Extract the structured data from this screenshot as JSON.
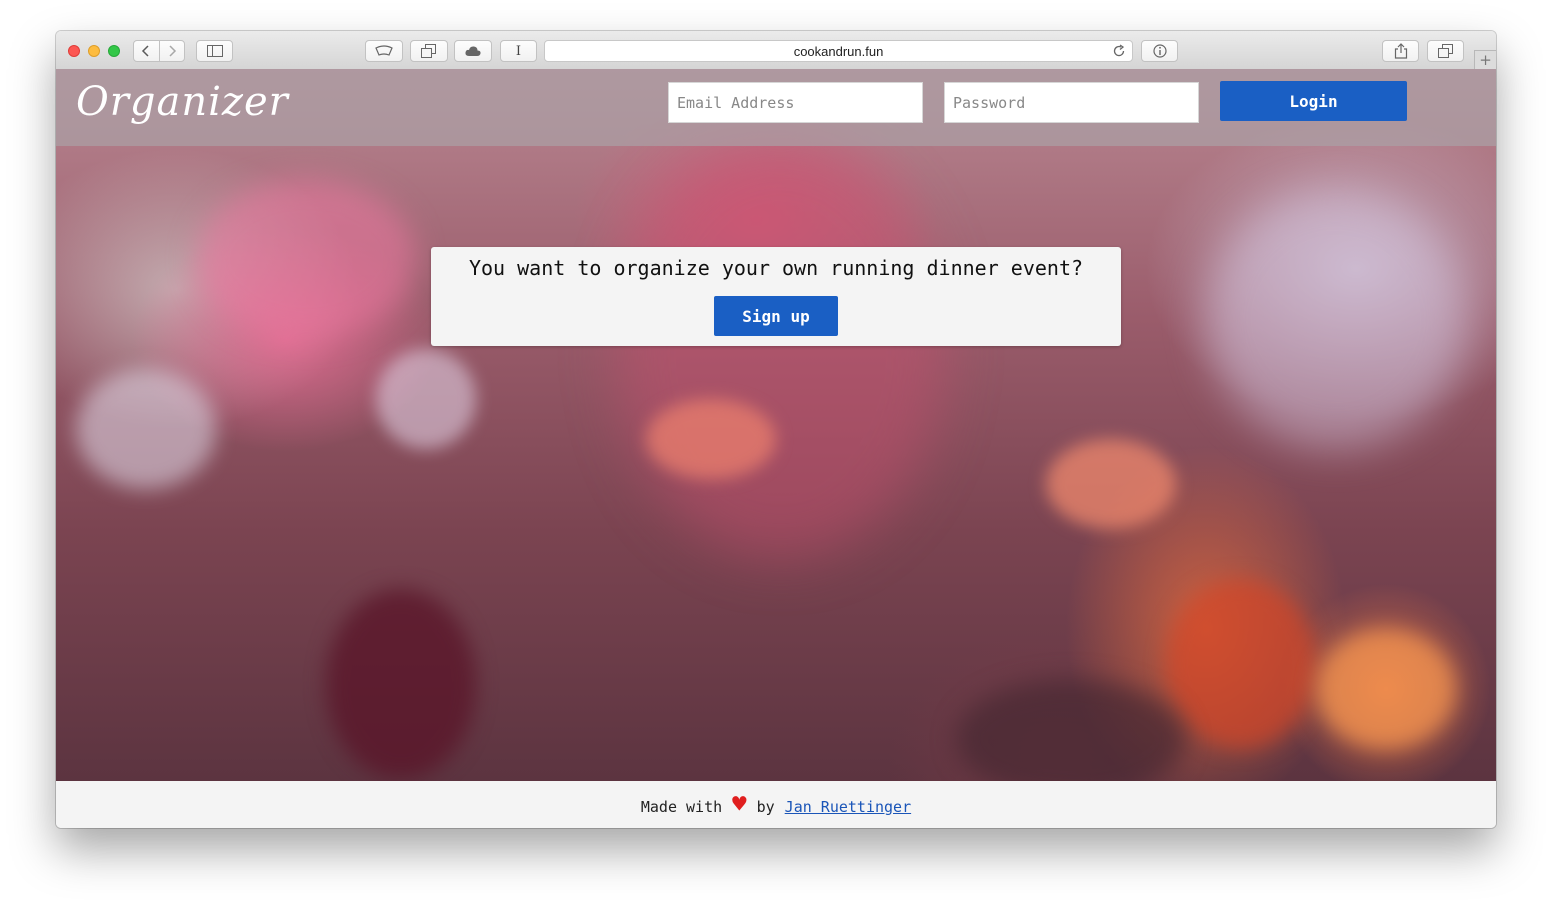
{
  "browser": {
    "url": "cookandrun.fun"
  },
  "header": {
    "logo": "Organizer",
    "email_placeholder": "Email Address",
    "password_placeholder": "Password",
    "login_label": "Login"
  },
  "hero": {
    "prompt": "You want to organize your own running dinner event?",
    "signup_label": "Sign up"
  },
  "footer": {
    "made_with": "Made with",
    "heart": "♥",
    "by": "by",
    "author": "Jan Ruettinger"
  },
  "colors": {
    "primary_button": "#1a5fc4",
    "heart": "#e01e1e",
    "link": "#1a55b8"
  }
}
